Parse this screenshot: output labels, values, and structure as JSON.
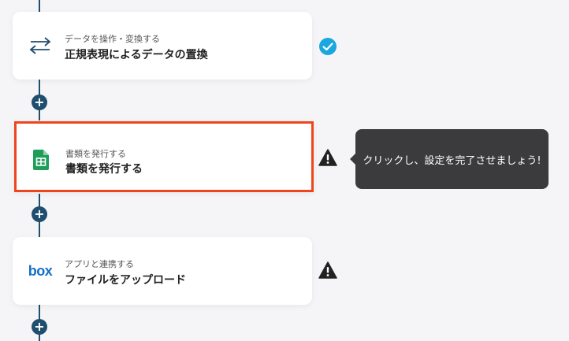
{
  "steps": [
    {
      "subtitle": "データを操作・変換する",
      "title": "正規表現によるデータの置換",
      "icon": "swap-arrows-icon",
      "status": "complete"
    },
    {
      "subtitle": "書類を発行する",
      "title": "書類を発行する",
      "icon": "google-sheets-icon",
      "status": "warning"
    },
    {
      "subtitle": "アプリと連携する",
      "title": "ファイルをアップロード",
      "icon": "box-logo",
      "logo_text": "box",
      "status": "warning"
    }
  ],
  "tooltip": {
    "text": "クリックし、設定を完了させましょう!"
  },
  "colors": {
    "connector": "#1f4e6e",
    "highlight_border": "#f0441c",
    "check": "#1aa6de",
    "warning": "#222222",
    "tooltip_bg": "#3b3b3d"
  }
}
